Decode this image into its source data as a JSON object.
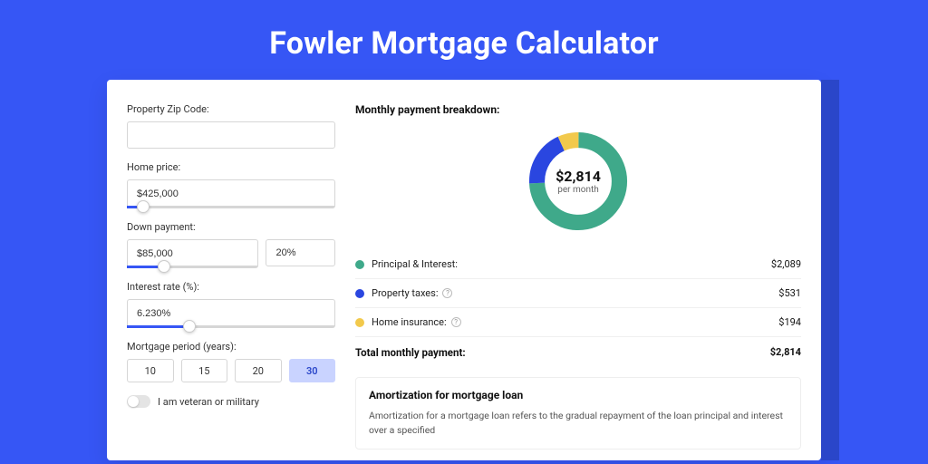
{
  "page": {
    "title": "Fowler Mortgage Calculator"
  },
  "inputs": {
    "zip": {
      "label": "Property Zip Code:",
      "value": ""
    },
    "home_price": {
      "label": "Home price:",
      "value": "$425,000",
      "slider_pct": 8
    },
    "down_payment": {
      "label": "Down payment:",
      "amount": "$85,000",
      "pct": "20%",
      "slider_pct": 28
    },
    "interest_rate": {
      "label": "Interest rate (%):",
      "value": "6.230%",
      "slider_pct": 30
    },
    "period": {
      "label": "Mortgage period (years):",
      "options": [
        "10",
        "15",
        "20",
        "30"
      ],
      "selected": "30"
    },
    "veteran": {
      "label": "I am veteran or military",
      "value": false
    }
  },
  "breakdown": {
    "heading": "Monthly payment breakdown:",
    "total_label": "Total monthly payment:",
    "total_value": "$2,814",
    "donut": {
      "center_big": "$2,814",
      "center_small": "per month"
    },
    "items": [
      {
        "label": "Principal & Interest:",
        "value": "$2,089",
        "color": "#3fa98a",
        "has_info": false
      },
      {
        "label": "Property taxes:",
        "value": "$531",
        "color": "#2a46e0",
        "has_info": true
      },
      {
        "label": "Home insurance:",
        "value": "$194",
        "color": "#f2c94c",
        "has_info": true
      }
    ]
  },
  "amortization": {
    "heading": "Amortization for mortgage loan",
    "body": "Amortization for a mortgage loan refers to the gradual repayment of the loan principal and interest over a specified"
  },
  "chart_data": {
    "type": "pie",
    "title": "Monthly payment breakdown",
    "series": [
      {
        "name": "Principal & Interest",
        "value": 2089,
        "color": "#3fa98a"
      },
      {
        "name": "Property taxes",
        "value": 531,
        "color": "#2a46e0"
      },
      {
        "name": "Home insurance",
        "value": 194,
        "color": "#f2c94c"
      }
    ],
    "total": 2814,
    "unit": "USD/month"
  }
}
